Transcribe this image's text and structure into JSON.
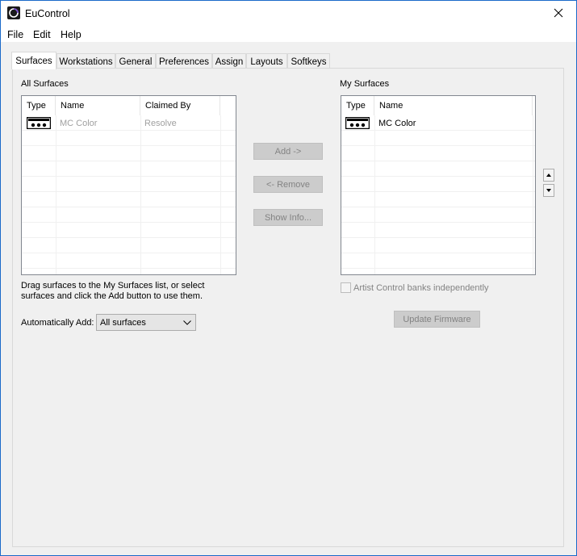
{
  "window": {
    "title": "EuControl"
  },
  "menu": [
    "File",
    "Edit",
    "Help"
  ],
  "tabs": [
    "Surfaces",
    "Workstations",
    "General",
    "Preferences",
    "Assign",
    "Layouts",
    "Softkeys"
  ],
  "all_surfaces": {
    "title": "All Surfaces",
    "columns": [
      "Type",
      "Name",
      "Claimed By"
    ],
    "rows": [
      {
        "type_icon": "control-surface-icon",
        "name": "MC Color",
        "claimed_by": "Resolve"
      }
    ]
  },
  "my_surfaces": {
    "title": "My Surfaces",
    "columns": [
      "Type",
      "Name"
    ],
    "rows": [
      {
        "type_icon": "control-surface-icon",
        "name": "MC Color"
      }
    ]
  },
  "buttons": {
    "add": "Add ->",
    "remove": "<- Remove",
    "show_info": "Show Info...",
    "update_firmware": "Update Firmware"
  },
  "hint": {
    "line1": "Drag surfaces to the My Surfaces list, or select",
    "line2": "surfaces and click the Add button to use them."
  },
  "auto_add": {
    "label": "Automatically Add:",
    "value": "All surfaces"
  },
  "artist_control": {
    "label": "Artist Control banks independently",
    "checked": false
  }
}
